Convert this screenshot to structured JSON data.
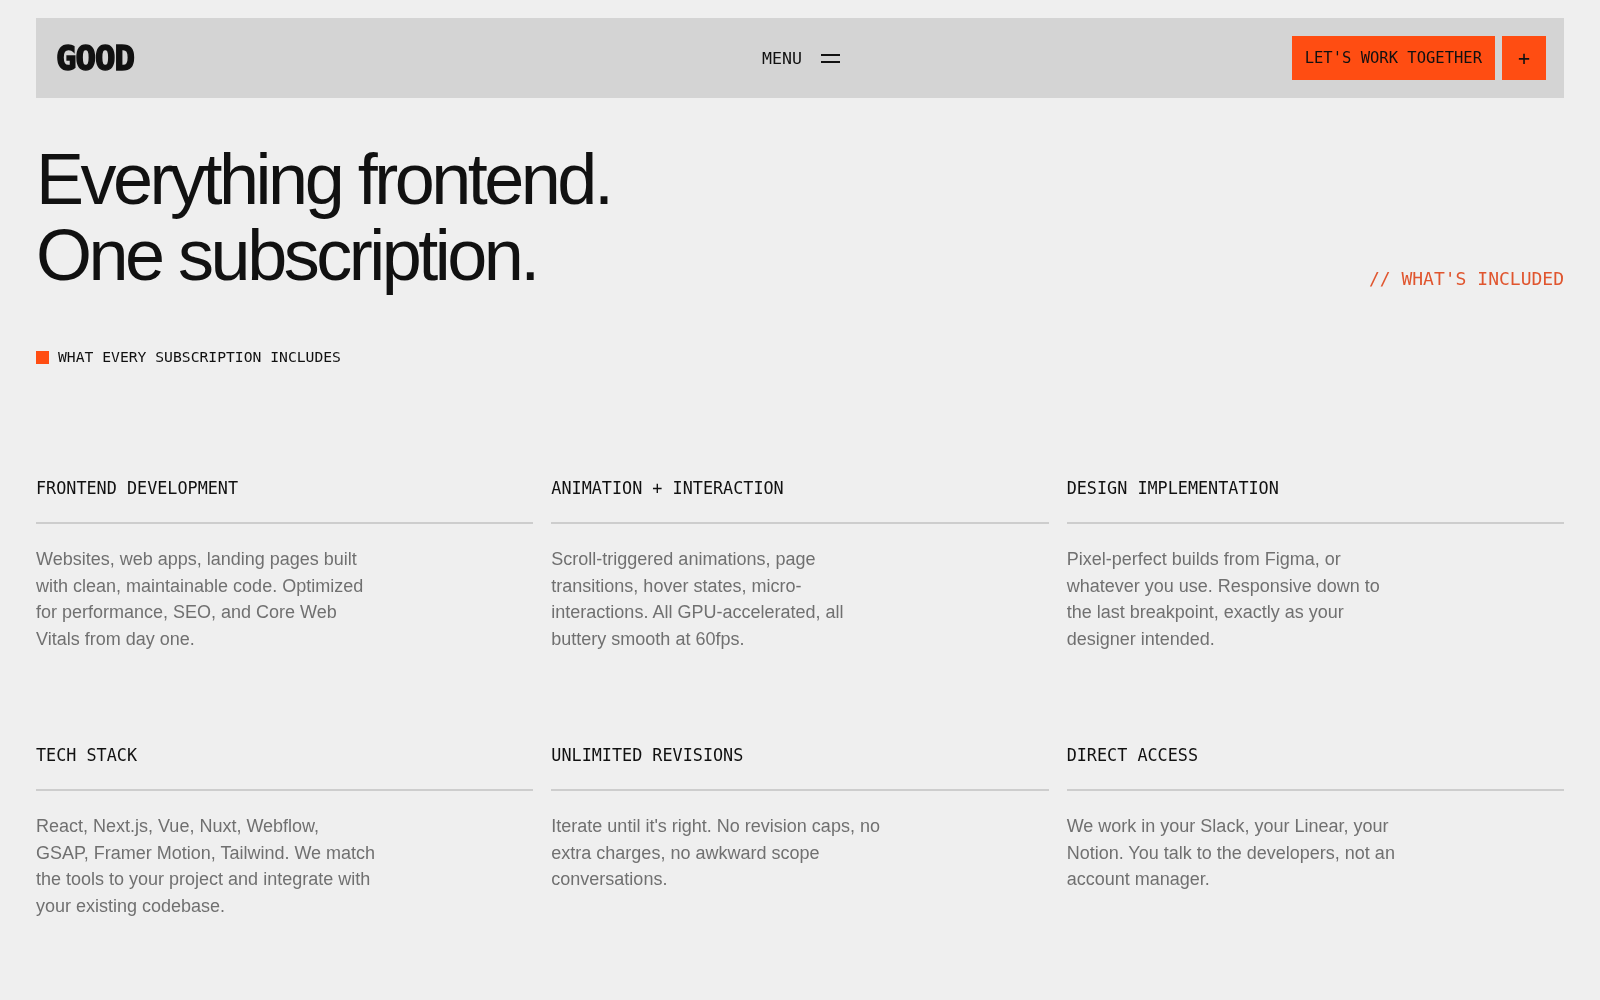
{
  "header": {
    "logo": "GOOD",
    "menu": {
      "label": "MENU"
    },
    "cta": {
      "label": "LET'S WORK TOGETHER"
    },
    "plus": {
      "label": "+"
    }
  },
  "hero": {
    "headline_lines": [
      "Everything frontend.",
      "One subscription."
    ],
    "section_tag": "// WHAT'S INCLUDED"
  },
  "section_label": "WHAT EVERY SUBSCRIPTION INCLUDES",
  "features": [
    {
      "title": "FRONTEND DEVELOPMENT",
      "description": "Websites, web apps, landing pages built with clean, maintainable code. Optimized for performance, SEO, and Core Web Vitals from day one."
    },
    {
      "title": "ANIMATION + INTERACTION",
      "description": "Scroll-triggered animations, page transitions, hover states, micro-interactions. All GPU-accelerated, all buttery smooth at 60fps."
    },
    {
      "title": "DESIGN IMPLEMENTATION",
      "description": "Pixel-perfect builds from Figma, or whatever you use. Responsive down to the last breakpoint, exactly as your designer intended."
    },
    {
      "title": "TECH STACK",
      "description": "React, Next.js, Vue, Nuxt, Webflow, GSAP, Framer Motion, Tailwind. We match the tools to your project and integrate with your existing codebase."
    },
    {
      "title": "UNLIMITED REVISIONS",
      "description": "Iterate until it's right. No revision caps, no extra charges, no awkward scope conversations."
    },
    {
      "title": "DIRECT ACCESS",
      "description": "We work in your Slack, your Linear, your Notion. You talk to the developers, not an account manager."
    }
  ]
}
